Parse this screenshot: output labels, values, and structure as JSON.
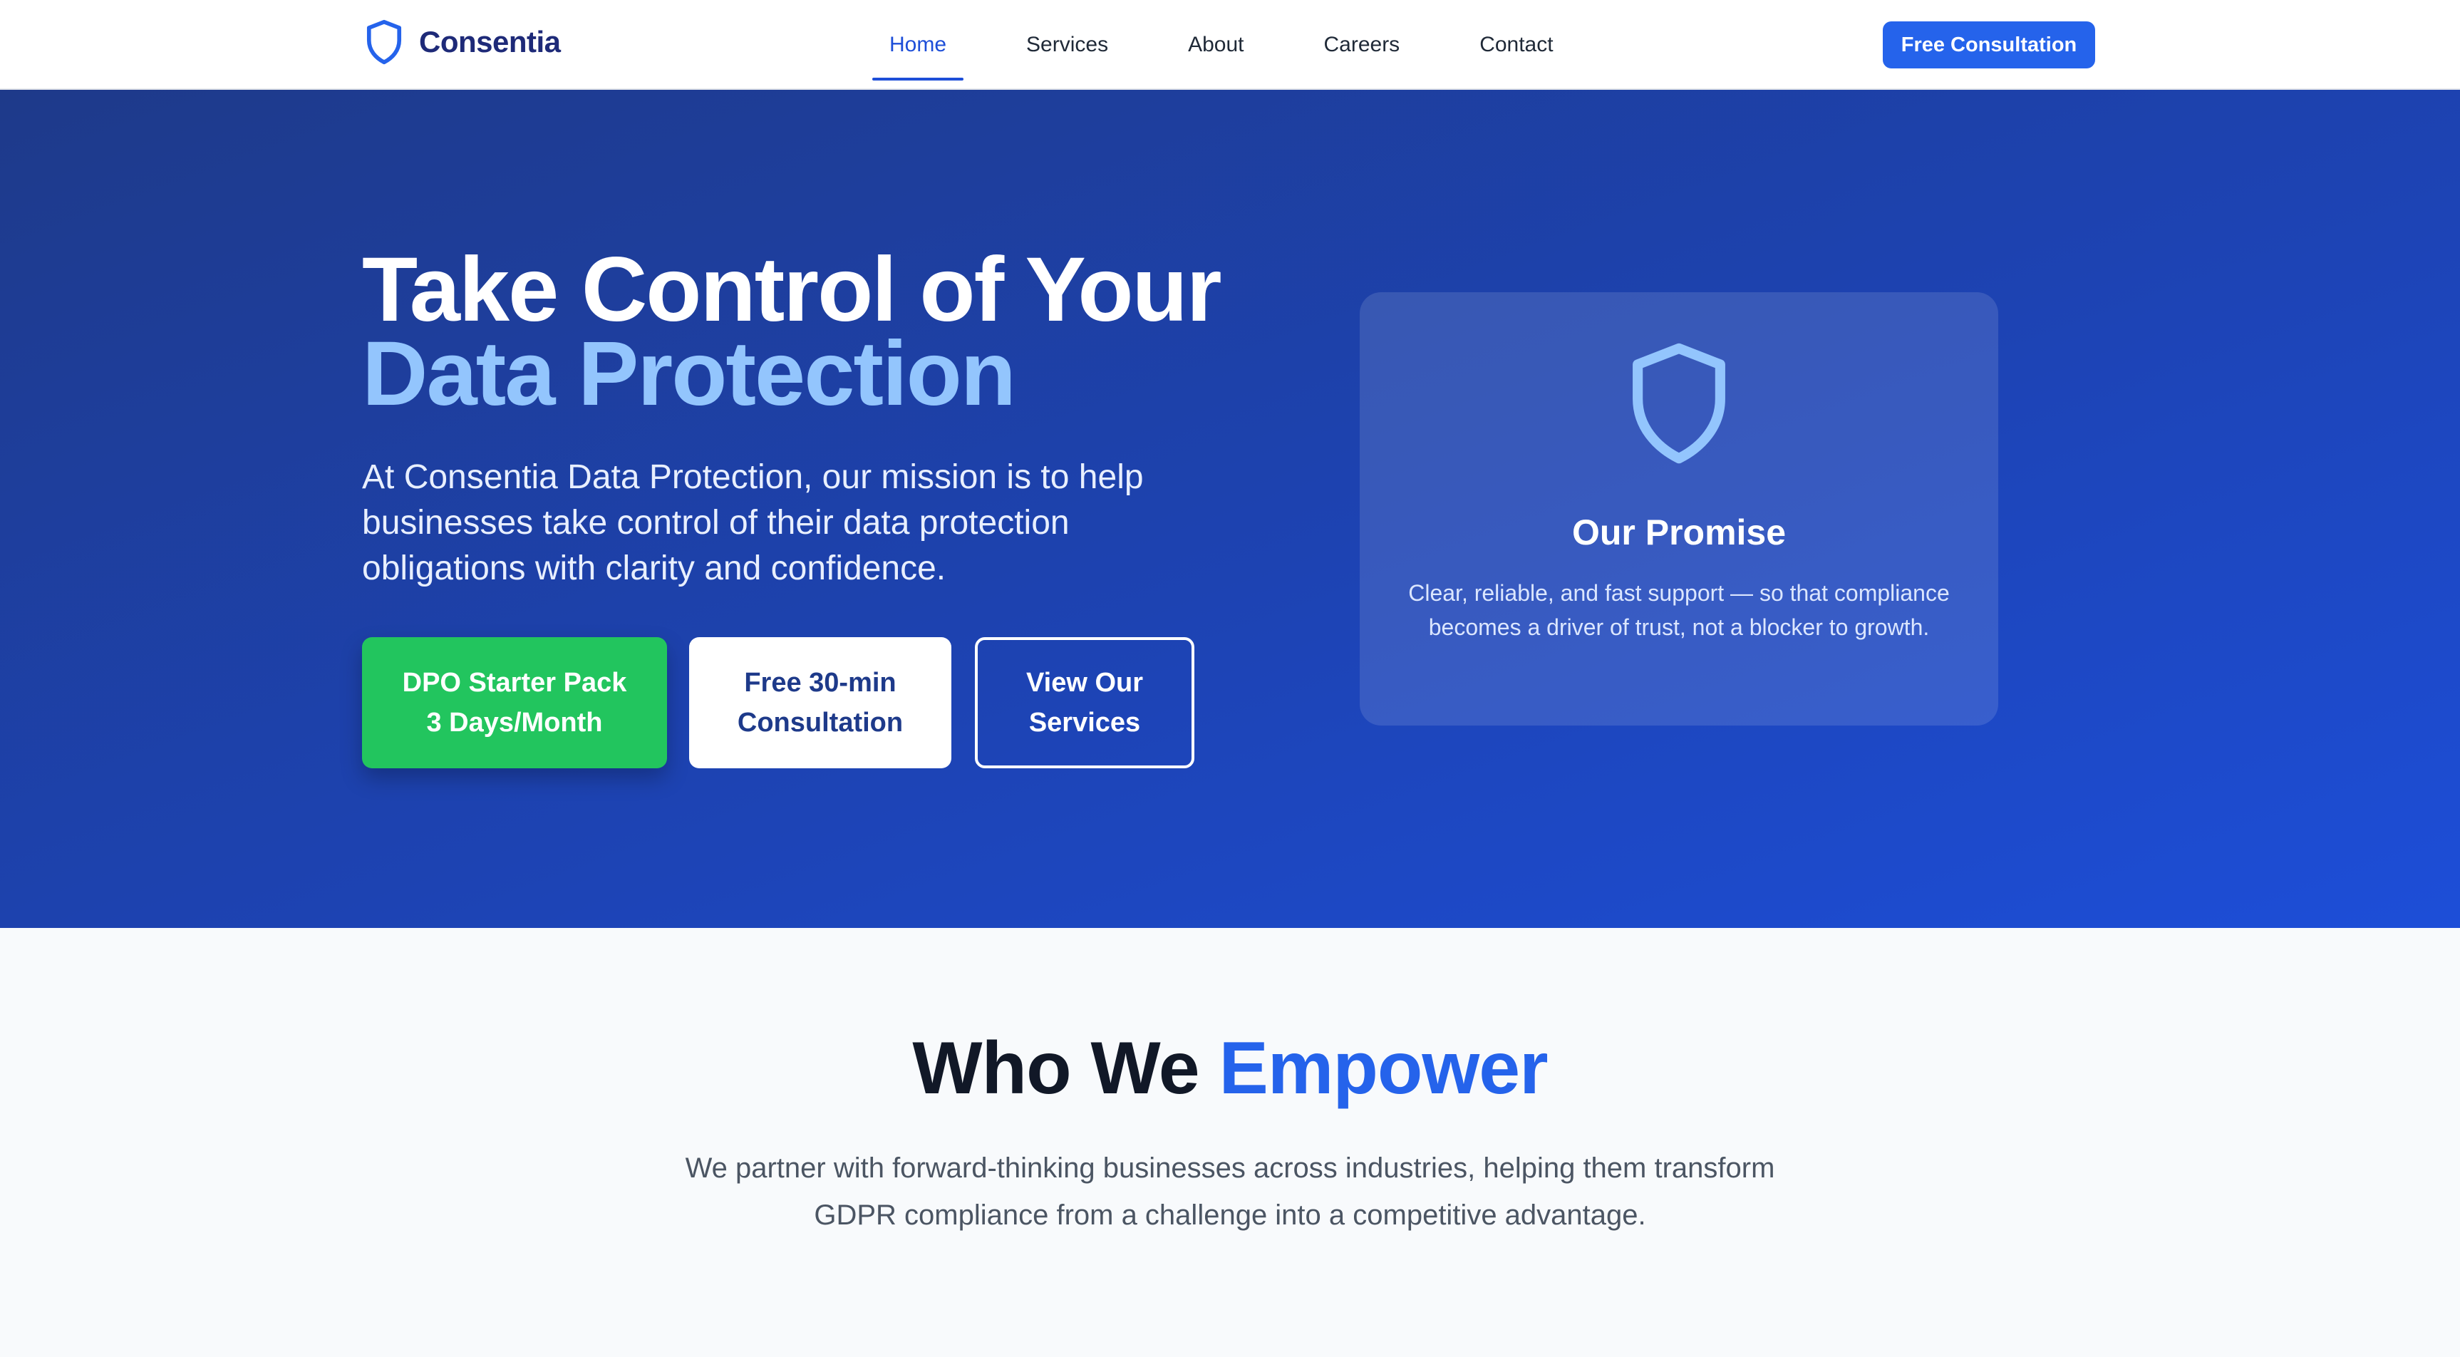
{
  "nav": {
    "brand": "Consentia",
    "links": [
      {
        "label": "Home",
        "active": true
      },
      {
        "label": "Services",
        "active": false
      },
      {
        "label": "About",
        "active": false
      },
      {
        "label": "Careers",
        "active": false
      },
      {
        "label": "Contact",
        "active": false
      }
    ],
    "cta_label": "Free Consultation",
    "logo_icon": "shield-icon"
  },
  "hero": {
    "title_line1": "Take Control of Your",
    "title_line2": "Data Protection",
    "subtitle": "At Consentia Data Protection, our mission is to help businesses take control of their data protection obligations with clarity and confidence.",
    "buttons": [
      {
        "label": "DPO Starter Pack\n3 Days/Month"
      },
      {
        "label": "Free 30-min\nConsultation"
      },
      {
        "label": "View Our\nServices"
      }
    ],
    "promise": {
      "icon": "shield-icon",
      "title": "Our Promise",
      "text": "Clear, reliable, and fast support — so that compliance becomes a driver of trust, not a blocker to growth."
    }
  },
  "empower": {
    "title_part1": "Who We",
    "title_accent": "Empower",
    "text": "We partner with forward-thinking businesses across industries, helping them transform GDPR compliance from a challenge into a competitive advantage."
  },
  "colors": {
    "brand_blue": "#2563eb",
    "hero_start": "#1e3a8a",
    "hero_end": "#1d4ed8",
    "accent_light": "#93c5fd",
    "cta_green": "#22c55e"
  }
}
